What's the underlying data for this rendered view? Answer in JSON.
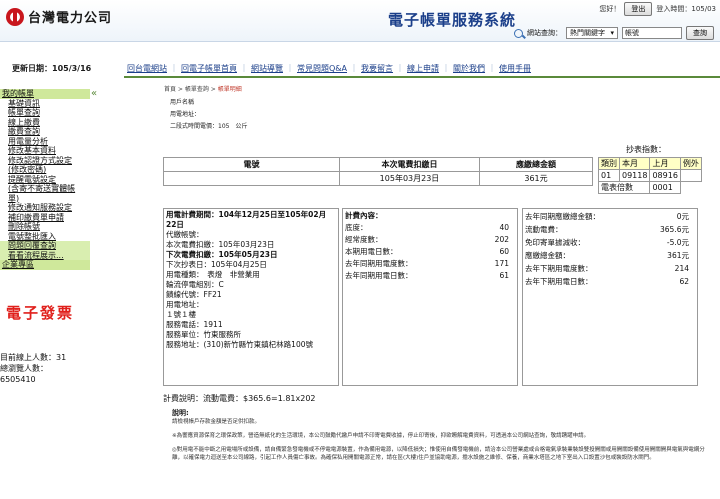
{
  "header": {
    "logo_text": "台灣電力公司",
    "system_title": "電子帳單服務系統",
    "greeting": "您好！",
    "logout_label": "登出",
    "login_time": "登入時間：105/03",
    "search_label": "網站查詢：",
    "search_select": "熱門關鍵字",
    "search_value": "帳號",
    "search_button": "查詢"
  },
  "sidebar": {
    "update_date": "更新日期：105/3/16",
    "items": [
      {
        "label": "我的帳單",
        "type": "sec"
      },
      {
        "label": "基礎資訊",
        "type": "item"
      },
      {
        "label": "帳單查詢",
        "type": "item"
      },
      {
        "label": "線上繳費",
        "type": "item"
      },
      {
        "label": "繳費查詢",
        "type": "item"
      },
      {
        "label": "用電量分析",
        "type": "item"
      },
      {
        "label": "修改基本資料",
        "type": "item"
      },
      {
        "label": "修改認證方式設定",
        "type": "item"
      },
      {
        "label": "(修改密碼)",
        "type": "item"
      },
      {
        "label": "提醒電號設定",
        "type": "item"
      },
      {
        "label": "(含寄不寄送實體帳",
        "type": "item"
      },
      {
        "label": "單)",
        "type": "item"
      },
      {
        "label": "修改通知服務設定",
        "type": "item"
      },
      {
        "label": "補印繳費單申請",
        "type": "item"
      },
      {
        "label": "刪除帳號",
        "type": "item"
      },
      {
        "label": "電號整批匯入",
        "type": "item"
      },
      {
        "label": "問題回覆查詢",
        "type": "hl"
      },
      {
        "label": "看看流程展示...",
        "type": "hl"
      },
      {
        "label": "企業專區",
        "type": "sec"
      }
    ],
    "ebill_label": "電子發票",
    "online_count": "目前線上人數：31",
    "visits_label": "總瀏覽人數：",
    "visits_value": "6505410"
  },
  "nav": [
    "回台電網站",
    "回電子帳單首頁",
    "網站導覽",
    "常見問題Q&A",
    "我要留言",
    "線上申請",
    "關於我們",
    "使用手冊"
  ],
  "breadcrumb": {
    "home": "首頁",
    "parent": "帳單查詢",
    "current": "帳單明細"
  },
  "account": {
    "name_label": "用戶名稱",
    "address_label": "用電地址：",
    "contract": "二段式時間電價：105　公斤"
  },
  "main_table": {
    "headers": [
      "電號",
      "本次電費扣繳日",
      "應繳總金額"
    ],
    "row": [
      "",
      "105年03月23日",
      "361元"
    ]
  },
  "meter": {
    "title": "抄表指數：",
    "headers": [
      "類別",
      "本月",
      "上月",
      "例外"
    ],
    "row": [
      "01",
      "09118",
      "08916",
      ""
    ],
    "multiplier_label": "電表倍數",
    "multiplier_value": "0001"
  },
  "period": {
    "title": "用電計費期間：104年12月25日至105年02月22日",
    "lines": [
      "代繳帳號：",
      "本次電費扣繳：105年03月23日"
    ],
    "next_deduct": "下次電費扣繳：105年05月23日",
    "lines2": [
      "下次抄表日：105年04月25日",
      "用電種類：　表燈　非營業用",
      "輪流停電組別：C",
      "饋線代號：FF21",
      "用電地址：",
      "１號１樓",
      "服務電話：1911",
      "服務單位：竹東服務所",
      "服務地址：(310)新竹縣竹東鎮杞林路100號"
    ]
  },
  "charges": {
    "title": "計費內容：",
    "rows": [
      {
        "label": "底度：",
        "value": "40"
      },
      {
        "label": "經常度數：",
        "value": "202"
      },
      {
        "label": "本期用電日數：",
        "value": "60"
      },
      {
        "label": "去年同期用電度數：",
        "value": "171"
      },
      {
        "label": "去年同期用電日數：",
        "value": "61"
      }
    ]
  },
  "amounts": {
    "rows": [
      {
        "label": "去年同期應繳總金額：",
        "value": "0元"
      },
      {
        "label": "流動電費：",
        "value": "365.6元"
      },
      {
        "label": "免印寄單據減收：",
        "value": "-5.0元"
      },
      {
        "label": "應繳總金額：",
        "value": "361元"
      },
      {
        "label": "去年下期用電度數：",
        "value": "214"
      },
      {
        "label": "去年下期用電日數：",
        "value": "62"
      }
    ]
  },
  "calc": "計費說明：流動電費：$365.6=1.81x202",
  "notes": {
    "title": "說明:",
    "p1": "請檢視帳戶存款金額是否足供扣款。",
    "p2": "※為響應資源保育之環保政策，營造無紙化的生活環境，本公司鼓勵代繳戶申請不印寄電費收據，停止印寄後，抑欲瞭解電費資料，可透過本公司網站查詢，敬請踴躍申請。",
    "p3": "◎對用電不能中斷之用電場所或設備，請自備緊急發電機或不停電電源裝置，作為備用電源，以降低損失；惟使用自備發電機前，請洽本公司營業處或合格電氣承裝業裝設雙投開關或用開關設備使用開關開與電氣與電網分離，以確保電力迴送至本公司線路，引起工作人員傷亡事故。為確保私用開關電源正常，請在區(大樓)住戶並協助電源，擔水設施之維修、保養，商業水塔區之地下室出入口設置沙包或裝設防水閘門。"
  }
}
